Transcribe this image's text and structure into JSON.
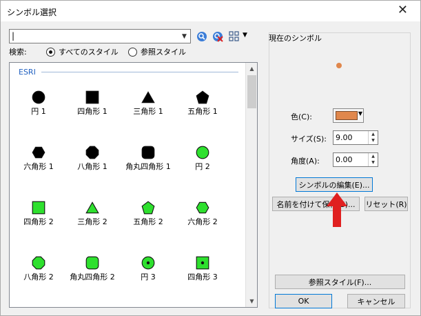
{
  "window": {
    "title": "シンボル選択",
    "close_glyph": "✕"
  },
  "search": {
    "label": "検索:",
    "value": "|"
  },
  "radios": [
    {
      "label": "すべてのスタイル",
      "selected": true
    },
    {
      "label": "参照スタイル",
      "selected": false
    }
  ],
  "gallery": {
    "group_label": "ESRI",
    "symbols": [
      {
        "label": "円 1",
        "shape": "circle",
        "color": "#000000"
      },
      {
        "label": "四角形 1",
        "shape": "square",
        "color": "#000000"
      },
      {
        "label": "三角形 1",
        "shape": "triangle",
        "color": "#000000"
      },
      {
        "label": "五角形 1",
        "shape": "pentagon",
        "color": "#000000"
      },
      {
        "label": "六角形 1",
        "shape": "hexagon",
        "color": "#000000"
      },
      {
        "label": "八角形 1",
        "shape": "octagon",
        "color": "#000000"
      },
      {
        "label": "角丸四角形 1",
        "shape": "rounded-square",
        "color": "#000000"
      },
      {
        "label": "円 2",
        "shape": "circle",
        "color": "#2ee02e"
      },
      {
        "label": "四角形 2",
        "shape": "square",
        "color": "#2ee02e"
      },
      {
        "label": "三角形 2",
        "shape": "triangle",
        "color": "#2ee02e"
      },
      {
        "label": "五角形 2",
        "shape": "pentagon",
        "color": "#2ee02e"
      },
      {
        "label": "六角形 2",
        "shape": "hexagon",
        "color": "#2ee02e"
      },
      {
        "label": "八角形 2",
        "shape": "octagon",
        "color": "#2ee02e"
      },
      {
        "label": "角丸四角形 2",
        "shape": "rounded-square",
        "color": "#2ee02e"
      },
      {
        "label": "円 3",
        "shape": "circle-dot",
        "color": "#2ee02e"
      },
      {
        "label": "四角形 3",
        "shape": "square-dot",
        "color": "#2ee02e"
      }
    ]
  },
  "current_symbol": {
    "legend": "現在のシンボル",
    "preview_color": "#e0874c",
    "color_label": "色(C):",
    "color_value": "#e0874c",
    "size_label": "サイズ(S):",
    "size_value": "9.00",
    "angle_label": "角度(A):",
    "angle_value": "0.00",
    "edit_button": "シンボルの編集(E)...",
    "save_as_button": "名前を付けて保存(S)...",
    "reset_button": "リセット(R)"
  },
  "footer": {
    "style_ref_button": "参照スタイル(F)...",
    "ok_button": "OK",
    "cancel_button": "キャンセル"
  }
}
